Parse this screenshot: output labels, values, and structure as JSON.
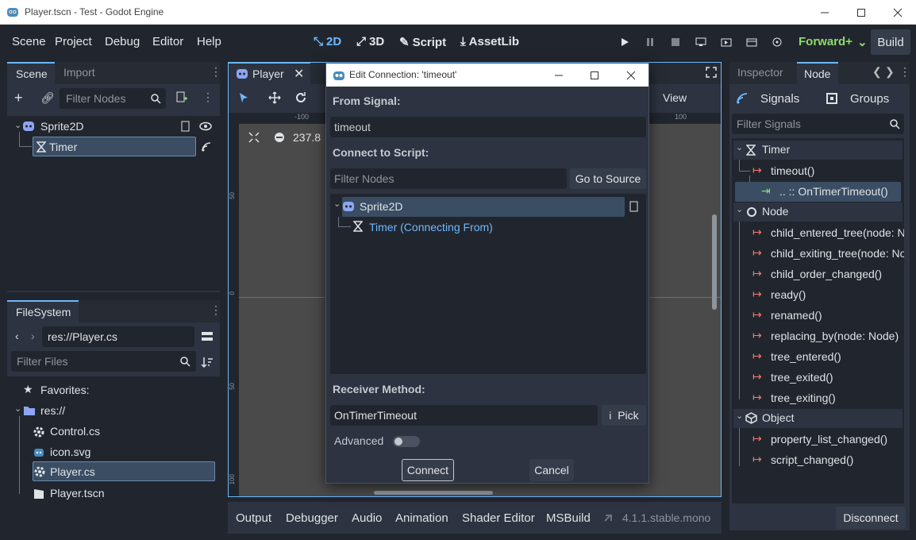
{
  "window": {
    "title": "Player.tscn - Test - Godot Engine"
  },
  "menu": {
    "items": [
      "Scene",
      "Project",
      "Debug",
      "Editor",
      "Help"
    ]
  },
  "workspaces": [
    {
      "label": "2D",
      "selected": true
    },
    {
      "label": "3D",
      "selected": false
    },
    {
      "label": "Script",
      "selected": false
    },
    {
      "label": "AssetLib",
      "selected": false
    }
  ],
  "renderer": "Forward+",
  "build_label": "Build",
  "scene_dock": {
    "tabs": [
      "Scene",
      "Import"
    ],
    "filter_placeholder": "Filter Nodes",
    "nodes": [
      {
        "name": "Sprite2D",
        "icon": "sprite-icon"
      },
      {
        "name": "Timer",
        "icon": "timer-icon",
        "selected": true
      }
    ]
  },
  "filesystem": {
    "tab": "FileSystem",
    "path": "res://Player.cs",
    "filter_placeholder": "Filter Files",
    "favorites_label": "Favorites:",
    "root": "res://",
    "files": [
      {
        "name": "Control.cs",
        "icon": "csharp-gear-icon"
      },
      {
        "name": "icon.svg",
        "icon": "image-icon"
      },
      {
        "name": "Player.cs",
        "icon": "csharp-gear-icon",
        "selected": true
      },
      {
        "name": "Player.tscn",
        "icon": "scene-clapper-icon"
      }
    ]
  },
  "viewport": {
    "tab_label": "Player",
    "view_label": "View",
    "zoom": "237.8",
    "ruler_top": [
      "-100",
      "100"
    ],
    "ruler_left": [
      "50",
      "0",
      "50",
      "100"
    ]
  },
  "bottom_panel": {
    "tabs": [
      "Output",
      "Debugger",
      "Audio",
      "Animation",
      "Shader Editor",
      "MSBuild"
    ],
    "version": "4.1.1.stable.mono"
  },
  "inspector": {
    "tabs": [
      "Inspector",
      "Node"
    ],
    "subtabs": [
      "Signals",
      "Groups"
    ],
    "filter_placeholder": "Filter Signals",
    "tree": [
      {
        "type": "class",
        "label": "Timer",
        "icon": "timer-icon"
      },
      {
        "type": "signal",
        "label": "timeout()"
      },
      {
        "type": "connection",
        "label": ".. :: OnTimerTimeout()"
      },
      {
        "type": "class",
        "label": "Node",
        "icon": "node-circle-icon"
      },
      {
        "type": "signal",
        "label": "child_entered_tree(node: Node)"
      },
      {
        "type": "signal",
        "label": "child_exiting_tree(node: Node)"
      },
      {
        "type": "signal",
        "label": "child_order_changed()"
      },
      {
        "type": "signal",
        "label": "ready()"
      },
      {
        "type": "signal",
        "label": "renamed()"
      },
      {
        "type": "signal",
        "label": "replacing_by(node: Node)"
      },
      {
        "type": "signal",
        "label": "tree_entered()"
      },
      {
        "type": "signal",
        "label": "tree_exited()"
      },
      {
        "type": "signal",
        "label": "tree_exiting()"
      },
      {
        "type": "class",
        "label": "Object",
        "icon": "object-cube-icon"
      },
      {
        "type": "signal",
        "label": "property_list_changed()"
      },
      {
        "type": "signal",
        "label": "script_changed()"
      }
    ],
    "disconnect_label": "Disconnect"
  },
  "dialog": {
    "title": "Edit Connection: 'timeout'",
    "from_signal_label": "From Signal:",
    "signal_value": "timeout",
    "connect_to_label": "Connect to Script:",
    "filter_placeholder": "Filter Nodes",
    "go_to_source": "Go to Source",
    "tree": [
      {
        "name": "Sprite2D"
      },
      {
        "name": "Timer (Connecting From)"
      }
    ],
    "receiver_label": "Receiver Method:",
    "receiver_value": "OnTimerTimeout",
    "pick_label": "Pick",
    "advanced_label": "Advanced",
    "connect_label": "Connect",
    "cancel_label": "Cancel"
  },
  "colors": {
    "accent": "#6db8ff",
    "signal": "#ff7b6b",
    "connection": "#7ce07c",
    "renderer": "#8ddc6b"
  }
}
